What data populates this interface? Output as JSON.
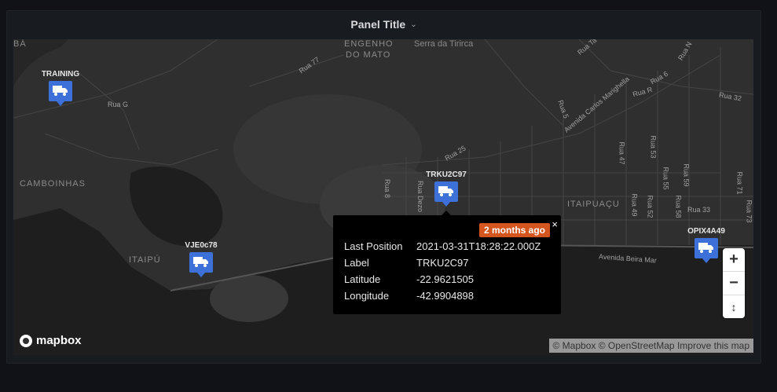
{
  "panel": {
    "title": "Panel Title"
  },
  "map": {
    "places": [
      "BÁ",
      "ENGENHO",
      "DO MATO",
      "Serra da Tirirca",
      "CAMBOINHAS",
      "ITAIPÚ",
      "ITAIPUAÇU"
    ],
    "streets": [
      "Rua 77",
      "Rua G",
      "Rua 25",
      "Rua 8",
      "Rua Dezo",
      "Rua 5",
      "Avenida Carlos Marighella",
      "Rua 6",
      "Rua R",
      "Rua 32",
      "Rua 47",
      "Rua 53",
      "Rua 55",
      "Rua 59",
      "Rua 71",
      "Rua 49",
      "Rua 52",
      "Rua 58",
      "Rua 33",
      "Rua 73",
      "Avenida Beira Mar",
      "Rua Ta",
      "Rua N"
    ],
    "markers": [
      {
        "label": "TRAINING"
      },
      {
        "label": "TRKU2C97"
      },
      {
        "label": "VJE0c78"
      },
      {
        "label": "OPIX4A49"
      }
    ]
  },
  "popup": {
    "badge": "2 months ago",
    "close": "×",
    "rows": [
      {
        "key": "Last Position",
        "value": "2021-03-31T18:28:22.000Z"
      },
      {
        "key": "Label",
        "value": "TRKU2C97"
      },
      {
        "key": "Latitude",
        "value": "-22.9621505"
      },
      {
        "key": "Longitude",
        "value": "-42.9904898"
      }
    ]
  },
  "controls": {
    "zoom_in": "+",
    "zoom_out": "−",
    "compass": "↕"
  },
  "logo": {
    "text": "mapbox"
  },
  "attribution": {
    "mapbox": "© Mapbox",
    "osm": "© OpenStreetMap",
    "improve": "Improve this map"
  },
  "colors": {
    "marker": "#3d71d9",
    "badge": "#d4561e",
    "map_land": "#2f2f2f",
    "map_water": "#1e1e1e"
  },
  "icons": {
    "marker": "truck-icon",
    "logo": "mapbox-logo-icon"
  }
}
